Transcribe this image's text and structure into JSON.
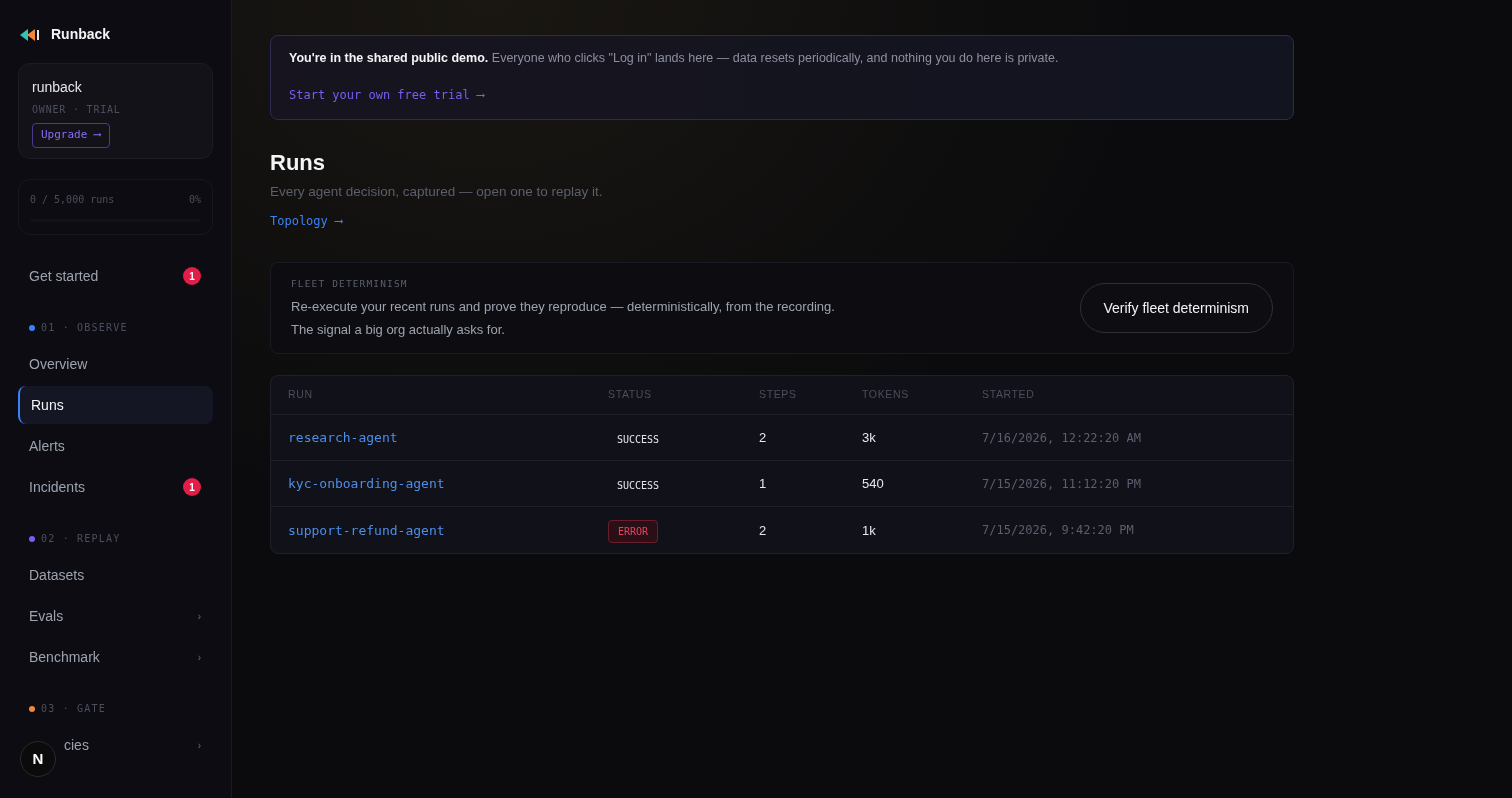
{
  "brand": {
    "name": "Runback"
  },
  "account": {
    "name": "runback",
    "role": "OWNER · TRIAL",
    "upgrade": "Upgrade ⟶"
  },
  "usage": {
    "label": "0 / 5,000 runs",
    "percent": "0%",
    "level": 0
  },
  "nav": [
    {
      "kind": "item",
      "label": "Get started",
      "badge": "1",
      "selected": false
    },
    {
      "kind": "section",
      "label": "01 · OBSERVE",
      "color": "#3b82f6"
    },
    {
      "kind": "item",
      "label": "Overview",
      "selected": false
    },
    {
      "kind": "item",
      "label": "Runs",
      "selected": true
    },
    {
      "kind": "item",
      "label": "Alerts",
      "selected": false
    },
    {
      "kind": "item",
      "label": "Incidents",
      "badge": "1",
      "selected": false
    },
    {
      "kind": "section",
      "label": "02 · REPLAY",
      "color": "#7c5cf0"
    },
    {
      "kind": "item",
      "label": "Datasets",
      "selected": false
    },
    {
      "kind": "item",
      "label": "Evals",
      "chevron": "›",
      "selected": false
    },
    {
      "kind": "item",
      "label": "Benchmark",
      "chevron": "›",
      "selected": false
    },
    {
      "kind": "section",
      "label": "03 · GATE",
      "color": "#f0863a"
    },
    {
      "kind": "item",
      "label": "cies",
      "chevron": "›",
      "selected": false,
      "covered": true
    }
  ],
  "dev_badge": "N",
  "banner": {
    "bold": "You're in the shared public demo.",
    "text": "Everyone who clicks \"Log in\" lands here — data resets periodically, and nothing you do here is private.",
    "link": "Start your own free trial ⟶"
  },
  "page": {
    "title": "Runs",
    "subtitle": "Every agent decision, captured — open one to replay it.",
    "link": "Topology ⟶"
  },
  "fleet": {
    "label": "FLEET DETERMINISM",
    "text": "Re-execute your recent runs and prove they reproduce — deterministically, from the recording.",
    "text2": "The signal a big org actually asks for.",
    "button": "Verify fleet determinism"
  },
  "table": {
    "columns": [
      "RUN",
      "STATUS",
      "STEPS",
      "TOKENS",
      "STARTED"
    ],
    "rows": [
      {
        "run": "research-agent",
        "status": "SUCCESS",
        "kind": "success",
        "steps": "2",
        "tokens": "3k",
        "started": "7/16/2026, 12:22:20 AM"
      },
      {
        "run": "kyc-onboarding-agent",
        "status": "SUCCESS",
        "kind": "success",
        "steps": "1",
        "tokens": "540",
        "started": "7/15/2026, 11:12:20 PM"
      },
      {
        "run": "support-refund-agent",
        "status": "ERROR",
        "kind": "error",
        "steps": "2",
        "tokens": "1k",
        "started": "7/15/2026, 9:42:20 PM"
      }
    ]
  }
}
